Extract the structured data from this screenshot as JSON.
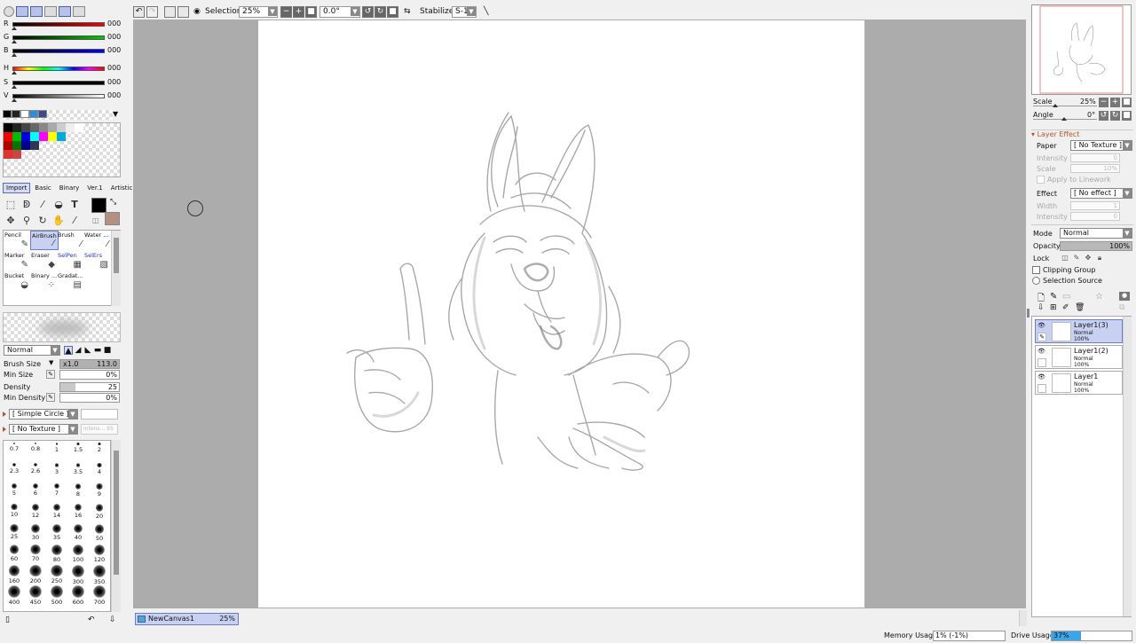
{
  "colors": {
    "r": {
      "label": "R",
      "value": "000"
    },
    "g": {
      "label": "G",
      "value": "000"
    },
    "b": {
      "label": "B",
      "value": "000"
    },
    "h": {
      "label": "H",
      "value": "000"
    },
    "s": {
      "label": "S",
      "value": "000"
    },
    "v": {
      "label": "V",
      "value": "000"
    },
    "main": "#000000",
    "sub": "#b49083"
  },
  "tool_tabs": [
    "Import",
    "Basic",
    "Binary",
    "Ver.1",
    "Artistic"
  ],
  "brushes": [
    {
      "label": "Pencil",
      "selected": false
    },
    {
      "label": "AirBrush",
      "selected": true
    },
    {
      "label": "Brush",
      "selected": false
    },
    {
      "label": "Water ...",
      "selected": false
    },
    {
      "label": "Marker",
      "selected": false
    },
    {
      "label": "Eraser",
      "selected": false
    },
    {
      "label": "SelPen",
      "selected": false
    },
    {
      "label": "SelErs",
      "selected": false
    },
    {
      "label": "Bucket",
      "selected": false
    },
    {
      "label": "Binary ...",
      "selected": false
    },
    {
      "label": "Gradat...",
      "selected": false
    }
  ],
  "brush_settings": {
    "blend_mode": "Normal",
    "brush_size_label": "Brush Size",
    "brush_size_mult": "x1.0",
    "brush_size_value": "113.0",
    "min_size_label": "Min Size",
    "min_size_value": "0%",
    "density_label": "Density",
    "density_value": "25",
    "min_density_label": "Min Density",
    "min_density_value": "0%",
    "shape": "[ Simple Circle ]",
    "texture": "[ No Texture ]",
    "texture_intensity": "Intens... 95"
  },
  "brush_sizes": [
    "0.7",
    "0.8",
    "1",
    "1.5",
    "2",
    "2.3",
    "2.6",
    "3",
    "3.5",
    "4",
    "5",
    "6",
    "7",
    "8",
    "9",
    "10",
    "12",
    "14",
    "16",
    "20",
    "25",
    "30",
    "35",
    "40",
    "50",
    "60",
    "70",
    "80",
    "100",
    "120",
    "160",
    "200",
    "250",
    "300",
    "350",
    "400",
    "450",
    "500",
    "600",
    "700"
  ],
  "toolbar": {
    "selection_label": "Selection",
    "zoom": "25%",
    "angle": "0.0°",
    "stabilizer_label": "Stabilizer",
    "stabilizer_value": "S-1"
  },
  "canvas_tab": {
    "name": "NewCanvas1",
    "zoom": "25%"
  },
  "navigator": {
    "scale_label": "Scale",
    "scale_value": "25%",
    "angle_label": "Angle",
    "angle_value": "0°"
  },
  "layer_effect": {
    "title": "Layer Effect",
    "paper_label": "Paper",
    "paper_value": "[ No Texture ]",
    "intensity_label": "Intensity",
    "intensity_value": "0",
    "scale_label": "Scale",
    "scale_value": "10%",
    "apply_label": "Apply to Linework",
    "effect_label": "Effect",
    "effect_value": "[ No effect ]",
    "width_label": "Width",
    "width_value": "1",
    "eff_intensity_label": "Intensity",
    "eff_intensity_value": "0"
  },
  "layer_props": {
    "mode_label": "Mode",
    "mode_value": "Normal",
    "opacity_label": "Opacity",
    "opacity_value": "100%",
    "lock_label": "Lock",
    "clipping_label": "Clipping Group",
    "selection_source_label": "Selection Source"
  },
  "layers": [
    {
      "name": "Layer1(3)",
      "mode": "Normal",
      "opacity": "100%",
      "selected": true
    },
    {
      "name": "Layer1(2)",
      "mode": "Normal",
      "opacity": "100%",
      "selected": false
    },
    {
      "name": "Layer1",
      "mode": "Normal",
      "opacity": "100%",
      "selected": false
    }
  ],
  "status": {
    "memory_label": "Memory Usage",
    "memory_value": "1% (-1%)",
    "drive_label": "Drive Usage",
    "drive_value": "37%",
    "drive_fraction": 0.37
  }
}
